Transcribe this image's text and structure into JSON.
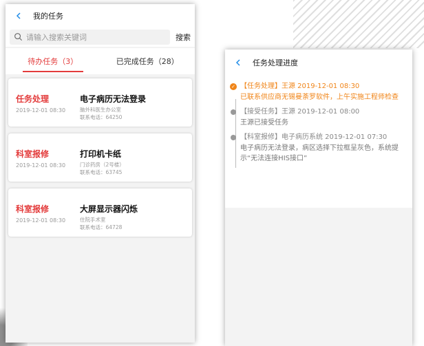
{
  "colors": {
    "accent": "#e33b3b",
    "progress_current": "#f08519",
    "back": "#1f8ce8"
  },
  "tasks_screen": {
    "title": "我的任务",
    "search": {
      "placeholder": "请输入搜索关键词",
      "button": "搜索"
    },
    "tabs": [
      {
        "label": "待办任务（3）",
        "active": true
      },
      {
        "label": "已完成任务（28）",
        "active": false
      }
    ],
    "tasks": [
      {
        "type": "任务处理",
        "time": "2019-12-01 08:30",
        "title": "电子病历无法登录",
        "dept": "脑外科医生办公室",
        "phone": "联系电话：64250"
      },
      {
        "type": "科室报修",
        "time": "2019-12-01 08:30",
        "title": "打印机卡纸",
        "dept": "门诊药房（2号楼）",
        "phone": "联系电话：63745"
      },
      {
        "type": "科室报修",
        "time": "2019-12-01 08:30",
        "title": "大屏显示器闪烁",
        "dept": "住院手术室",
        "phone": "联系电话：64728"
      }
    ]
  },
  "progress_screen": {
    "title": "任务处理进度",
    "entries": [
      {
        "head": "【任务处理】王源 2019-12-01 08:30",
        "body": "已联系供应商无锡曼荼罗软件，上午实施工程师检查",
        "current": true
      },
      {
        "head": "【接受任务】王源 2019-12-01 08:00",
        "body": "王源已接受任务",
        "current": false
      },
      {
        "head": "【科室报修】电子病历系统 2019-12-01 07:30",
        "body": "电子病历无法登录，病区选择下拉框呈灰色，系统提示“无法连接HIS接口”",
        "current": false
      }
    ]
  }
}
